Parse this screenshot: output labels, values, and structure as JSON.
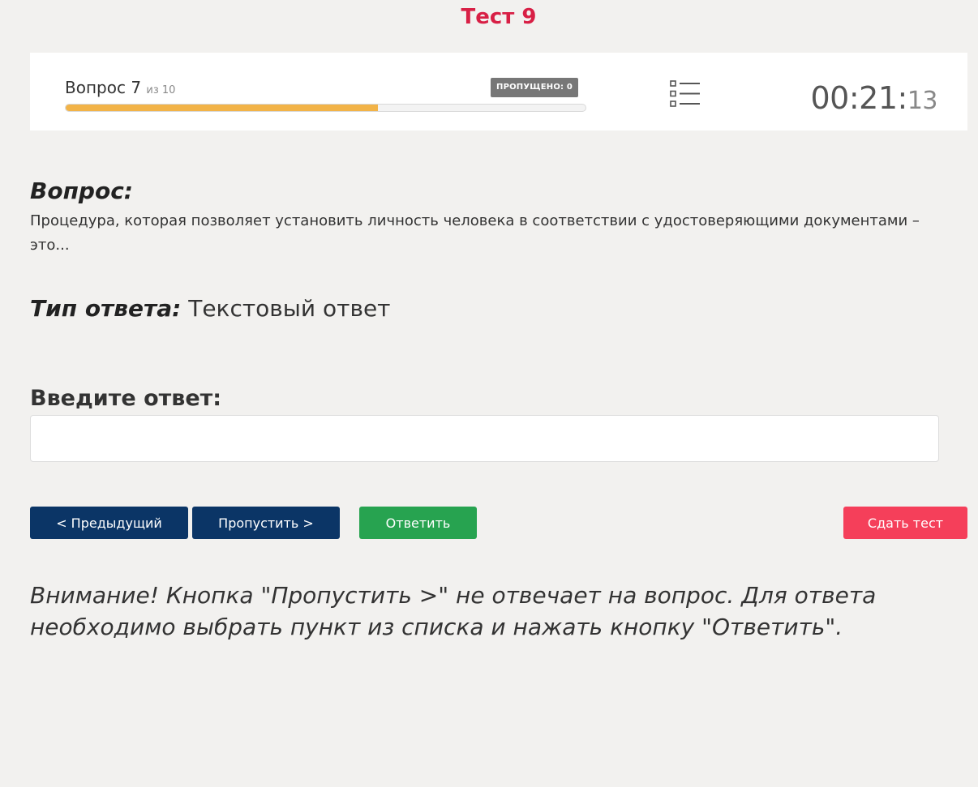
{
  "page": {
    "title": "Тест 9"
  },
  "status": {
    "question_label": "Вопрос 7",
    "question_of": "из 10",
    "skipped_badge": "ПРОПУЩЕНО: 0",
    "progress": 0.6,
    "list_icon": "list-icon",
    "timer_main": "00:21:",
    "timer_seconds": "13",
    "colors": {
      "progress_fill": "#f2b347",
      "badge_bg": "#777777"
    }
  },
  "question": {
    "heading": "Вопрос:",
    "text": "Процедура, которая позволяет установить личность человека в соответствии с удостоверяющими документами – это..."
  },
  "answer_type": {
    "label": "Тип ответа:",
    "value": " Текстовый ответ"
  },
  "answer": {
    "label": "Введите ответ:",
    "value": "",
    "placeholder": ""
  },
  "buttons": {
    "prev": "< Предыдущий",
    "skip": "Пропустить >",
    "answer": "Ответить",
    "submit": "Сдать тест",
    "colors": {
      "nav": "#0b3566",
      "answer": "#27a350",
      "submit": "#f53f5a"
    }
  },
  "warning": {
    "text": "Внимание! Кнопка \"Пропустить >\" не отвечает на вопрос. Для ответа необходимо выбрать пункт из списка и нажать кнопку \"Ответить\"."
  }
}
